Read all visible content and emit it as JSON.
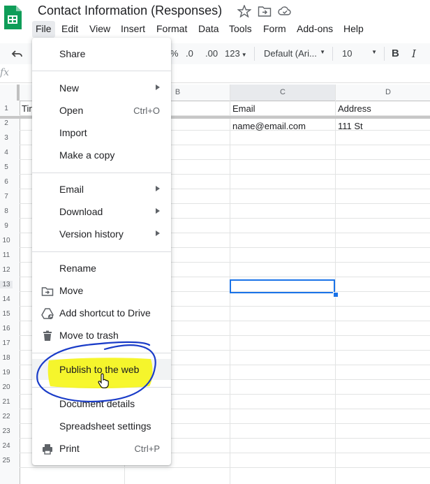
{
  "app": {
    "title": "Contact Information (Responses)",
    "menus": [
      "File",
      "Edit",
      "View",
      "Insert",
      "Format",
      "Data",
      "Tools",
      "Form",
      "Add-ons",
      "Help"
    ]
  },
  "toolbar": {
    "percent": "%",
    "decrease_decimals": ".0",
    "increase_decimals": ".00",
    "number_format": "123",
    "font_family": "Default (Ari...",
    "font_size": "10",
    "bold": "B",
    "italic": "I"
  },
  "formula_bar": {
    "fx": "fx"
  },
  "sheet": {
    "col_headers": [
      "B",
      "C",
      "D"
    ],
    "row_numbers": [
      "1",
      "2",
      "3",
      "4",
      "5",
      "6",
      "7",
      "8",
      "9",
      "10",
      "11",
      "12",
      "13",
      "14",
      "15",
      "16",
      "17",
      "18",
      "19",
      "20",
      "21",
      "22",
      "23",
      "24",
      "25"
    ],
    "a1_partial": "Tin",
    "c1": "Email",
    "d1": "Address",
    "c2": "name@email.com",
    "d2": "111 St"
  },
  "file_menu": {
    "share": "Share",
    "new": "New",
    "open": "Open",
    "open_shortcut": "Ctrl+O",
    "import": "Import",
    "make_copy": "Make a copy",
    "email": "Email",
    "download": "Download",
    "version_history": "Version history",
    "rename": "Rename",
    "move": "Move",
    "add_shortcut": "Add shortcut to Drive",
    "move_to_trash": "Move to trash",
    "publish": "Publish to the web",
    "document_details": "Document details",
    "spreadsheet_settings": "Spreadsheet settings",
    "print": "Print",
    "print_shortcut": "Ctrl+P"
  },
  "colors": {
    "accent_green": "#0f9d58",
    "selection_blue": "#1a73e8",
    "highlight_yellow": "#f5f500",
    "annotation_blue": "#1a3cc8"
  }
}
